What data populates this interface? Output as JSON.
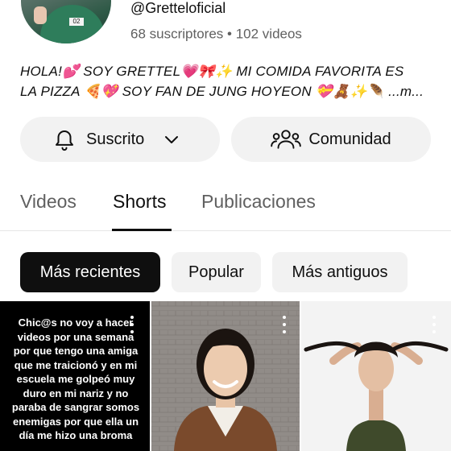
{
  "channel": {
    "handle": "@Gretteloficial",
    "subscribers": "68 suscriptores",
    "separator": "•",
    "videos": "102 videos",
    "bio_line1": "HOLA!💕 SOY GRETTEL💗🎀✨ MI COMIDA FAVORITA ES",
    "bio_line2": "LA PIZZA 🍕💖 SOY FAN DE JUNG HOYEON 💝🧸✨🪶 ...m..."
  },
  "buttons": {
    "subscribed_label": "Suscrito",
    "community_label": "Comunidad"
  },
  "tabs": [
    {
      "label": "Videos",
      "active": false
    },
    {
      "label": "Shorts",
      "active": true
    },
    {
      "label": "Publicaciones",
      "active": false
    }
  ],
  "filters": [
    {
      "label": "Más recientes",
      "active": true
    },
    {
      "label": "Popular",
      "active": false
    },
    {
      "label": "Más antiguos",
      "active": false
    }
  ],
  "shorts": [
    {
      "caption": "Chic@s no voy a hacer videos por una semana por que tengo una amiga que me traicionó y en mi escuela me golpeó muy duro en mi nariz y no paraba de sangrar somos enemigas por que ella un día me hizo una broma"
    },
    {
      "caption": ""
    },
    {
      "caption": ""
    }
  ],
  "icons": {
    "bell": "bell-icon",
    "chevron": "chevron-down-icon",
    "community": "people-icon",
    "more": "more-vert-icon"
  }
}
